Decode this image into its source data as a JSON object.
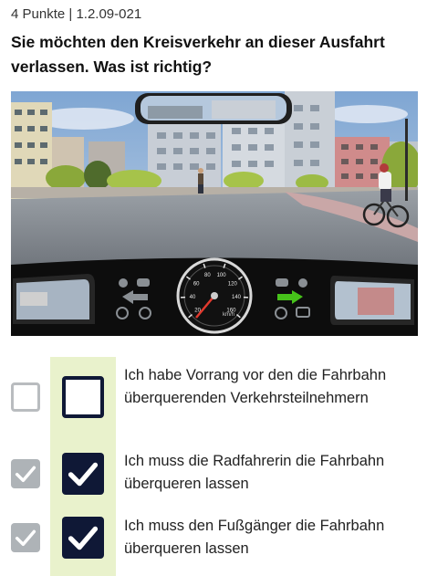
{
  "header": {
    "meta": "4 Punkte | 1.2.09-021",
    "question": "Sie möchten den Kreisverkehr an dieser Ausfahrt verlassen. Was ist richtig?"
  },
  "dashboard": {
    "speed_ticks": [
      "20",
      "40",
      "60",
      "80",
      "100",
      "120",
      "140",
      "160"
    ],
    "speed_unit": "km/h",
    "speed_value": 0,
    "right_indicator_on": true,
    "left_indicator_on": false
  },
  "answers": [
    {
      "text": "Ich habe Vorrang vor den die Fahrbahn überquerenden Verkehrsteilnehmern",
      "checked": false,
      "solution_checked": false
    },
    {
      "text": "Ich muss die Radfahrerin die Fahrbahn überqueren lassen",
      "checked": true,
      "solution_checked": true
    },
    {
      "text": "Ich muss den Fußgänger die Fahrbahn überqueren lassen",
      "checked": true,
      "solution_checked": true
    }
  ],
  "colors": {
    "checkbox_dark": "#0f1836",
    "checkbox_grey": "#aeb3b7",
    "highlight_column": "#e9f2cc",
    "indicator_green": "#46c21a",
    "indicator_grey": "#8a8f94"
  }
}
